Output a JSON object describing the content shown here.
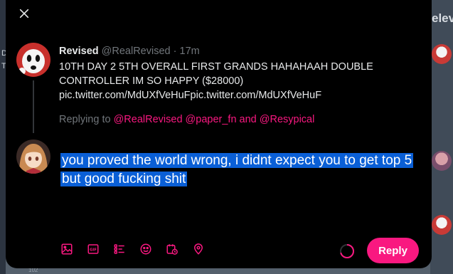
{
  "background": {
    "right_word": "elev",
    "left_text": [
      "D",
      "T"
    ],
    "bottom_text": [
      "102"
    ]
  },
  "tweet": {
    "name": "Revised",
    "handle": "@RealRevised",
    "separator": "·",
    "time": "17m",
    "text": "10TH DAY 2 5TH OVERALL FIRST GRANDS HAHAHAAH DOUBLE CONTROLLER IM SO HAPPY ($28000)",
    "link": "pic.twitter.com/MdUXfVeHuFpic.twitter.com/MdUXfVeHuF"
  },
  "replying": {
    "prefix": "Replying to ",
    "mention1": "@RealRevised",
    "mention2": "@paper_fn",
    "and": " and ",
    "mention3": "@Resypical"
  },
  "reply": {
    "text": "you proved the world wrong, i didnt expect you to get top 5 but good fucking shit"
  },
  "toolbar": {
    "icons": [
      "image-icon",
      "gif-icon",
      "poll-icon",
      "emoji-icon",
      "schedule-icon",
      "location-icon"
    ]
  },
  "reply_button": {
    "label": "Reply"
  },
  "colors": {
    "accent": "#f91880",
    "selection": "#0a5fd6",
    "muted": "#71767b",
    "modal_bg": "#000000"
  }
}
